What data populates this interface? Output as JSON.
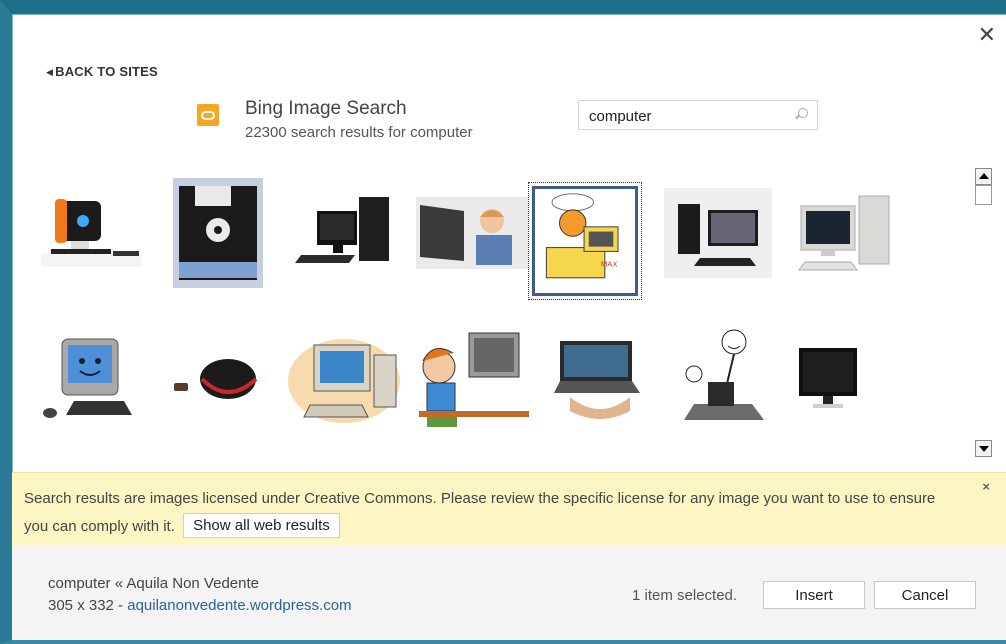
{
  "dialog": {
    "close_label": "✕",
    "back_label": "BACK TO SITES"
  },
  "provider": {
    "title": "Bing Image Search",
    "subtitle": "22300 search results for computer",
    "logo_color": "#f5a623"
  },
  "search": {
    "value": "computer",
    "icon": "search-icon"
  },
  "results": [
    {
      "name": "orange-retro-computer",
      "selected": false
    },
    {
      "name": "floppy-disk",
      "selected": false
    },
    {
      "name": "black-desktop-pc",
      "selected": false
    },
    {
      "name": "child-on-laptop",
      "selected": false
    },
    {
      "name": "garfield-computer-cartoon",
      "selected": true
    },
    {
      "name": "desktop-monitor-keyboard",
      "selected": false
    },
    {
      "name": "beige-pc-tower",
      "selected": false
    },
    {
      "name": "smiling-mac-computer",
      "selected": false
    },
    {
      "name": "wireless-mouse",
      "selected": false
    },
    {
      "name": "cartoon-desktop-computer",
      "selected": false
    },
    {
      "name": "cartoon-boy-at-computer",
      "selected": false
    },
    {
      "name": "laptop-on-hand",
      "selected": false
    },
    {
      "name": "stick-figure-at-computer",
      "selected": false
    },
    {
      "name": "black-monitor",
      "selected": false
    }
  ],
  "notice": {
    "text": "Search results are images licensed under Creative Commons. Please review the specific license for any image you want to use to ensure you can comply with it.",
    "show_all_label": "Show all web results",
    "close_label": "×",
    "background": "#fdf6c4"
  },
  "footer": {
    "selected_title": "computer « Aquila Non Vedente",
    "dimensions": "305 x 332 -",
    "source_link": "aquilanonvedente.wordpress.com",
    "selection_count": "1 item selected.",
    "insert_label": "Insert",
    "cancel_label": "Cancel"
  }
}
